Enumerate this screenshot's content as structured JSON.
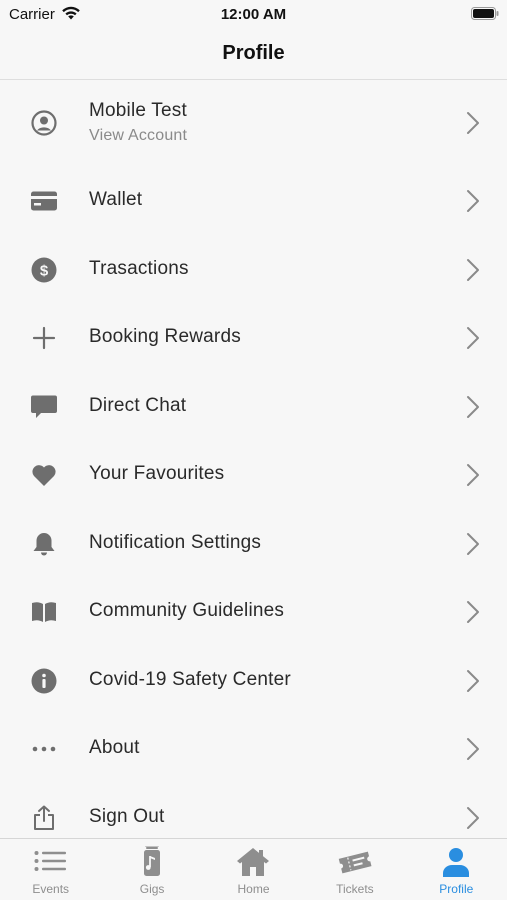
{
  "status_bar": {
    "carrier": "Carrier",
    "time": "12:00 AM"
  },
  "nav": {
    "title": "Profile"
  },
  "menu": {
    "account": {
      "name": "Mobile Test",
      "sub": "View Account",
      "icon": "user-circle-icon"
    },
    "items": [
      {
        "label": "Wallet",
        "icon": "credit-card-icon"
      },
      {
        "label": "Trasactions",
        "icon": "dollar-coin-icon"
      },
      {
        "label": "Booking Rewards",
        "icon": "plus-icon"
      },
      {
        "label": "Direct Chat",
        "icon": "chat-bubble-icon"
      },
      {
        "label": "Your Favourites",
        "icon": "heart-icon"
      },
      {
        "label": "Notification Settings",
        "icon": "bell-icon"
      },
      {
        "label": "Community Guidelines",
        "icon": "book-icon"
      },
      {
        "label": "Covid-19 Safety Center",
        "icon": "info-icon"
      },
      {
        "label": "About",
        "icon": "ellipsis-icon"
      },
      {
        "label": "Sign Out",
        "icon": "share-icon"
      }
    ]
  },
  "tabs": [
    {
      "label": "Events",
      "icon": "list-icon",
      "active": false
    },
    {
      "label": "Gigs",
      "icon": "music-note-icon",
      "active": false
    },
    {
      "label": "Home",
      "icon": "home-icon",
      "active": false
    },
    {
      "label": "Tickets",
      "icon": "tickets-icon",
      "active": false
    },
    {
      "label": "Profile",
      "icon": "person-icon",
      "active": true
    }
  ],
  "colors": {
    "accent": "#2a8ee0",
    "icon_gray": "#6e6e6e",
    "tab_gray": "#8e8e8e",
    "background": "#f7f7f7"
  }
}
